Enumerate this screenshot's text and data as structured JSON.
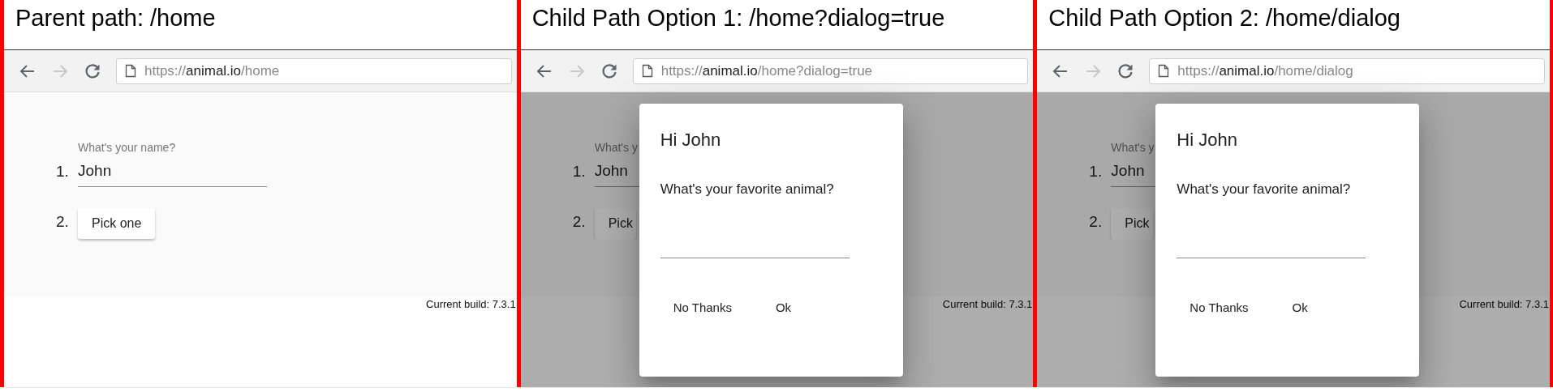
{
  "panels": [
    {
      "title": "Parent path: /home",
      "nav": [
        {
          "kind": "back",
          "disabled": false
        },
        {
          "kind": "forward",
          "disabled": true
        },
        {
          "kind": "reload",
          "disabled": false
        }
      ],
      "url": {
        "scheme": "https://",
        "host": "animal.io",
        "path": "/home"
      },
      "form": [
        {
          "number": "1.",
          "kind": "text-field",
          "label": "What's your name?",
          "value": "John"
        },
        {
          "number": "2.",
          "kind": "button",
          "label": "Pick one"
        }
      ],
      "footer": "Current build: 7.3.1"
    },
    {
      "title": "Child Path Option 1: /home?dialog=true",
      "nav": [
        {
          "kind": "back",
          "disabled": false
        },
        {
          "kind": "forward",
          "disabled": true
        },
        {
          "kind": "reload",
          "disabled": false
        }
      ],
      "url": {
        "scheme": "https://",
        "host": "animal.io",
        "path": "/home?dialog=true"
      },
      "form": [
        {
          "number": "1.",
          "kind": "text-field",
          "label": "What's y",
          "value": "John"
        },
        {
          "number": "2.",
          "kind": "button",
          "label": "Pick"
        }
      ],
      "footer": "Current build: 7.3.1",
      "dialog": {
        "title": "Hi John",
        "question": "What's your favorite animal?",
        "buttons": [
          "No Thanks",
          "Ok"
        ]
      }
    },
    {
      "title": "Child Path Option 2: /home/dialog",
      "nav": [
        {
          "kind": "back",
          "disabled": false
        },
        {
          "kind": "forward",
          "disabled": true
        },
        {
          "kind": "reload",
          "disabled": false
        }
      ],
      "url": {
        "scheme": "https://",
        "host": "animal.io",
        "path": "/home/dialog"
      },
      "form": [
        {
          "number": "1.",
          "kind": "text-field",
          "label": "What's y",
          "value": "John"
        },
        {
          "number": "2.",
          "kind": "button",
          "label": "Pick"
        }
      ],
      "footer": "Current build: 7.3.1",
      "dialog": {
        "title": "Hi John",
        "question": "What's your favorite animal?",
        "buttons": [
          "No Thanks",
          "Ok"
        ]
      }
    }
  ]
}
